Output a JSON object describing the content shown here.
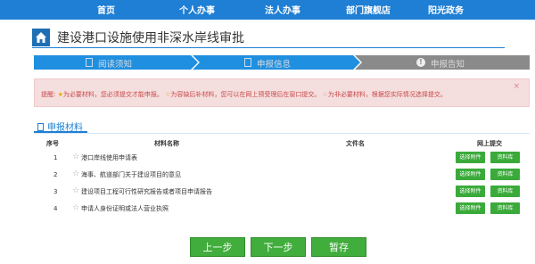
{
  "topnav": {
    "items": [
      "首页",
      "个人办事",
      "法人办事",
      "部门旗舰店",
      "阳光政务"
    ]
  },
  "page": {
    "title": "建设港口设施使用非深水岸线审批"
  },
  "steps": [
    {
      "label": "阅读须知",
      "icon": "document-icon"
    },
    {
      "label": "申报信息",
      "icon": "form-icon"
    },
    {
      "label": "申报告知",
      "icon": "exclamation-icon"
    }
  ],
  "alert": {
    "prefix": "提醒:",
    "required": "为必要材料，您必须提交才能申报。",
    "optional_late": "为容缺后补材料，您可以在网上预受理后在窗口提交。",
    "non_required": "为非必要材料，根据您实际情况选择提交。",
    "close": "×"
  },
  "section": {
    "title": "申报材料"
  },
  "table": {
    "headers": {
      "index": "序号",
      "material": "材料名称",
      "file": "文件名",
      "upload": "网上提交"
    },
    "rows": [
      {
        "index": "1",
        "name": "港口岸线使用申请表"
      },
      {
        "index": "2",
        "name": "海事、航道部门关于建设项目的意见"
      },
      {
        "index": "3",
        "name": "建设项目工程可行性研究报告或者项目申请报告"
      },
      {
        "index": "4",
        "name": "申请人身份证明或法人营业执照"
      }
    ],
    "select_label": "选择附件",
    "library_label": "资料库"
  },
  "buttons": {
    "prev": "上一步",
    "next": "下一步",
    "save": "暂存"
  },
  "colors": {
    "nav": "#1f7fd4",
    "step_active": "#1f8fe0",
    "step_inactive": "#8a8a8a",
    "green": "#41ad3c",
    "alert_bg": "#f5dede"
  }
}
